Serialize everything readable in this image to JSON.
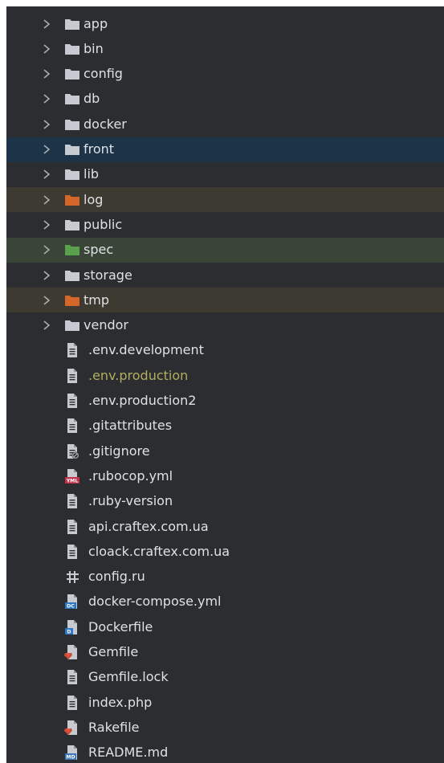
{
  "project_tree": {
    "folders": [
      {
        "name": "app",
        "state": "normal"
      },
      {
        "name": "bin",
        "state": "normal"
      },
      {
        "name": "config",
        "state": "normal"
      },
      {
        "name": "db",
        "state": "normal"
      },
      {
        "name": "docker",
        "state": "normal"
      },
      {
        "name": "front",
        "state": "selected"
      },
      {
        "name": "lib",
        "state": "normal"
      },
      {
        "name": "log",
        "state": "excluded"
      },
      {
        "name": "public",
        "state": "normal"
      },
      {
        "name": "spec",
        "state": "test"
      },
      {
        "name": "storage",
        "state": "normal"
      },
      {
        "name": "tmp",
        "state": "excluded"
      },
      {
        "name": "vendor",
        "state": "normal"
      }
    ],
    "files": [
      {
        "name": ".env.development",
        "icon": "text-file-icon"
      },
      {
        "name": ".env.production",
        "icon": "text-file-icon",
        "highlight": true
      },
      {
        "name": ".env.production2",
        "icon": "text-file-icon"
      },
      {
        "name": ".gitattributes",
        "icon": "text-file-icon"
      },
      {
        "name": ".gitignore",
        "icon": "ignored-file-icon"
      },
      {
        "name": ".rubocop.yml",
        "icon": "yml-file-icon",
        "badge": "YML"
      },
      {
        "name": ".ruby-version",
        "icon": "text-file-icon"
      },
      {
        "name": "api.craftex.com.ua",
        "icon": "text-file-icon"
      },
      {
        "name": "cloack.craftex.com.ua",
        "icon": "text-file-icon"
      },
      {
        "name": "config.ru",
        "icon": "hash-file-icon"
      },
      {
        "name": "docker-compose.yml",
        "icon": "docker-compose-file-icon",
        "badge": "DC"
      },
      {
        "name": "Dockerfile",
        "icon": "dockerfile-icon",
        "badge": "D"
      },
      {
        "name": "Gemfile",
        "icon": "gemfile-icon"
      },
      {
        "name": "Gemfile.lock",
        "icon": "text-file-icon"
      },
      {
        "name": "index.php",
        "icon": "text-file-icon"
      },
      {
        "name": "Rakefile",
        "icon": "rakefile-icon"
      },
      {
        "name": "README.md",
        "icon": "markdown-file-icon",
        "badge": "MD"
      }
    ]
  },
  "colors": {
    "panel_bg": "#2b2d30",
    "text": "#dfe1e5",
    "selected_row": "#1c3348",
    "excluded_row": "#3d3a31",
    "test_row": "#394637",
    "folder_normal": "#c7cad1",
    "folder_excluded": "#d4662a",
    "folder_test": "#5aa14d",
    "modified_text": "#b3ae60",
    "ruby_red": "#e0553f"
  }
}
